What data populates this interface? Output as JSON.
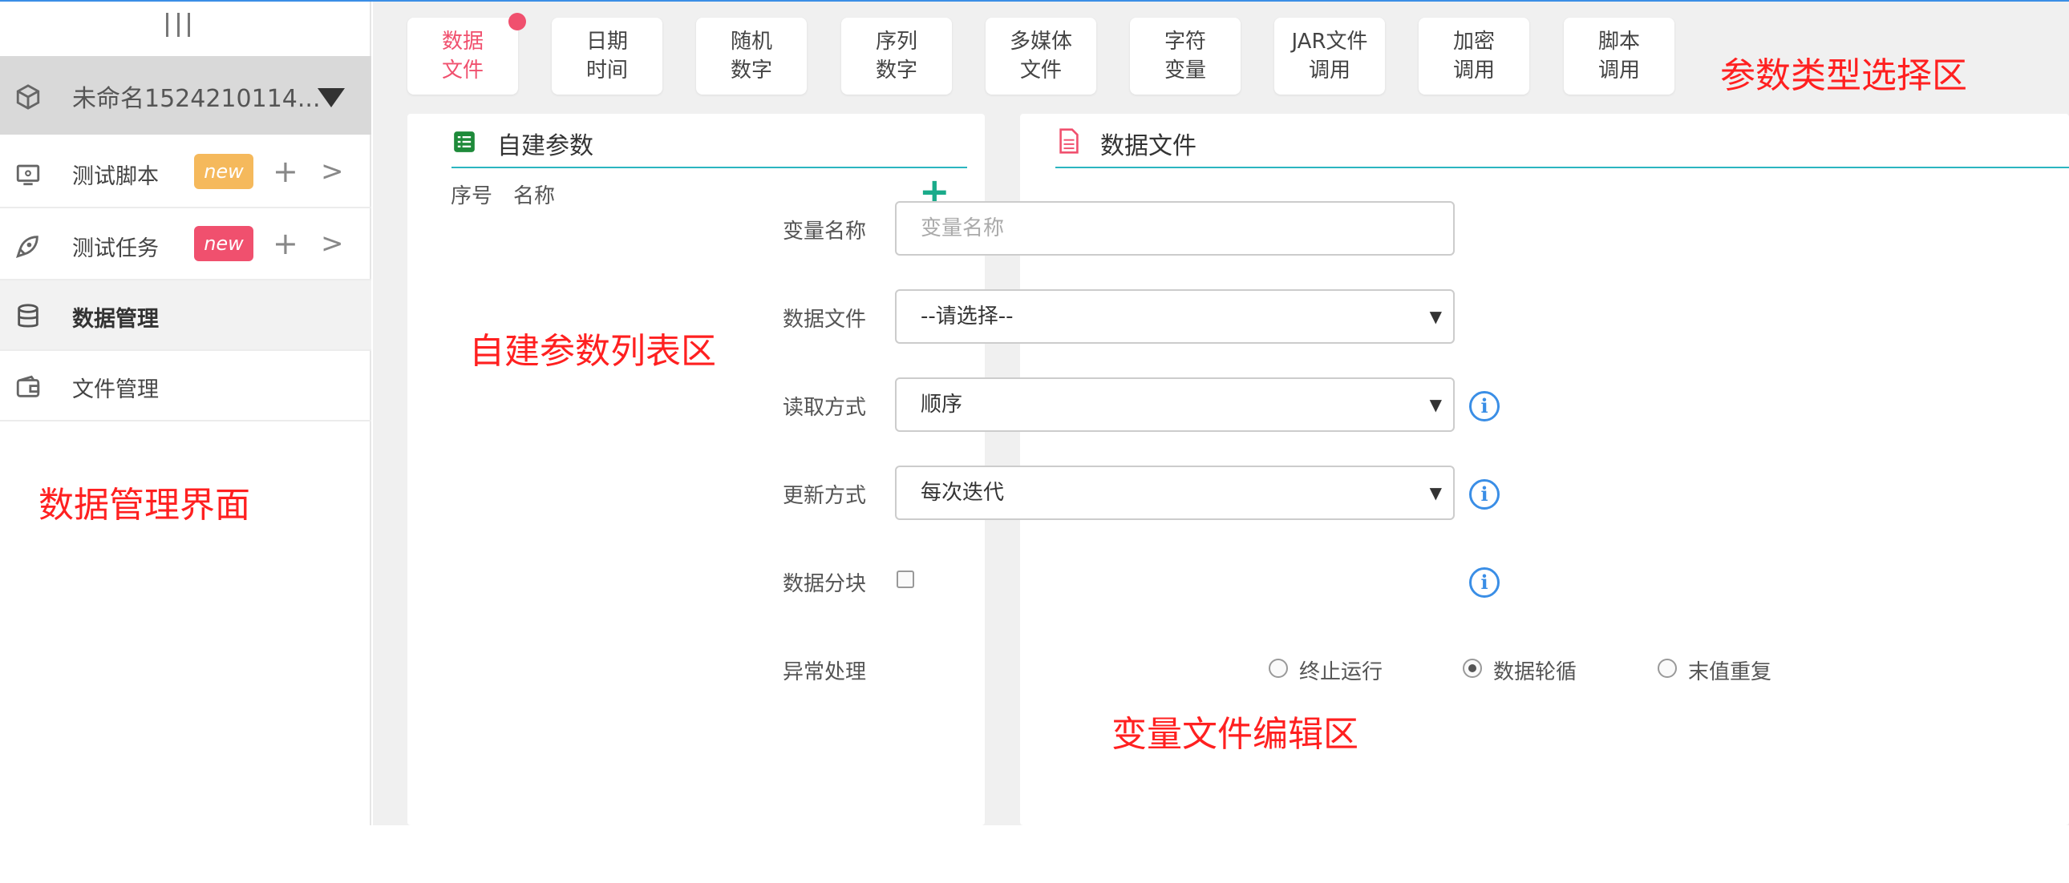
{
  "sidebar": {
    "project_name": "未命名1524210114...",
    "items": [
      {
        "label": "测试脚本",
        "badge": "new",
        "badge_color": "#f5b95c"
      },
      {
        "label": "测试任务",
        "badge": "new",
        "badge_color": "#f0506e"
      },
      {
        "label": "数据管理"
      },
      {
        "label": "文件管理"
      }
    ],
    "plus_glyph": "+",
    "chevron_glyph": ">"
  },
  "annotations": {
    "sidebar": "数据管理界面",
    "type_area": "参数类型选择区",
    "list_area": "自建参数列表区",
    "edit_area": "变量文件编辑区"
  },
  "param_types": [
    {
      "line1": "数据",
      "line2": "文件",
      "active": true
    },
    {
      "line1": "日期",
      "line2": "时间"
    },
    {
      "line1": "随机",
      "line2": "数字"
    },
    {
      "line1": "序列",
      "line2": "数字"
    },
    {
      "line1": "多媒体",
      "line2": "文件"
    },
    {
      "line1": "字符",
      "line2": "变量"
    },
    {
      "line1": "JAR文件",
      "line2": "调用"
    },
    {
      "line1": "加密",
      "line2": "调用"
    },
    {
      "line1": "脚本",
      "line2": "调用"
    }
  ],
  "custom_params": {
    "title": "自建参数",
    "col_index": "序号",
    "col_name": "名称",
    "add_glyph": "+"
  },
  "data_file": {
    "title": "数据文件",
    "var_name_label": "变量名称",
    "var_name_placeholder": "变量名称",
    "file_label": "数据文件",
    "file_value": "--请选择--",
    "read_label": "读取方式",
    "read_value": "顺序",
    "update_label": "更新方式",
    "update_value": "每次迭代",
    "chunk_label": "数据分块",
    "error_label": "异常处理",
    "error_options": [
      "终止运行",
      "数据轮循",
      "末值重复"
    ],
    "error_selected": "数据轮循",
    "info_glyph": "i",
    "select_arrow": "▼"
  },
  "colors": {
    "accent_red": "#f0506e",
    "annotation_red": "#ff2020",
    "teal": "#2bb5c0",
    "add_green": "#1aab8a",
    "info_blue": "#3a8ee6"
  }
}
